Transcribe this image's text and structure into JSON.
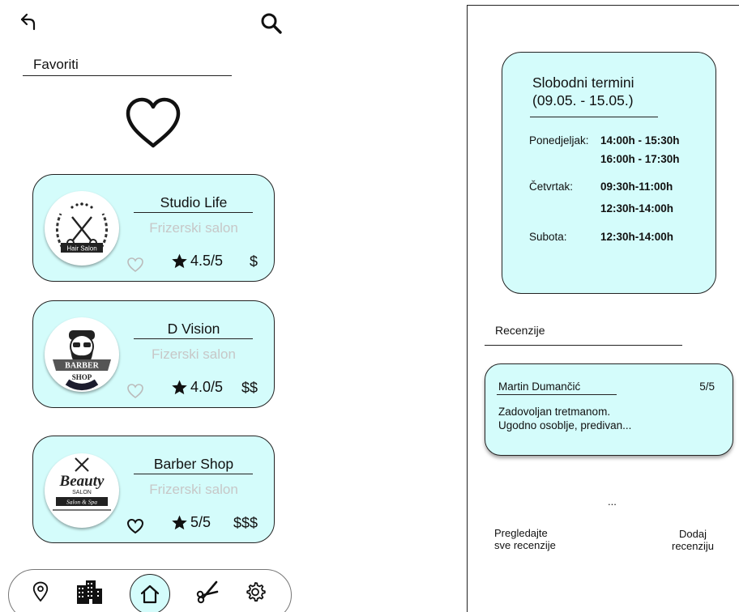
{
  "left_screen": {
    "title": "Favoriti",
    "cards": [
      {
        "name": "Studio Life",
        "type": "Frizerski salon",
        "rating": "4.5/5",
        "price": "$",
        "logo_text": "Hair Salon",
        "favorited": false
      },
      {
        "name": "D Vision",
        "type": "Fizerski salon",
        "rating": "4.0/5",
        "price": "$$",
        "logo_text_top": "BARBER",
        "logo_text_bottom": "SHOP",
        "favorited": false
      },
      {
        "name": "Barber Shop",
        "type": "Frizerski salon",
        "rating": "5/5",
        "price": "$$$",
        "logo_text_top": "Beauty",
        "logo_text_mid": "SALON",
        "logo_text_bottom": "Salon & Spa",
        "favorited": true
      }
    ],
    "nav": [
      "location-icon",
      "buildings-icon",
      "home-icon",
      "scissors-icon",
      "settings-icon"
    ]
  },
  "right_screen": {
    "slots_title_line1": "Slobodni termini",
    "slots_title_line2": "(09.05. - 15.05.)",
    "days": [
      {
        "day": "Ponedjeljak:",
        "times": [
          "14:00h - 15:30h",
          "16:00h - 17:30h"
        ]
      },
      {
        "day": "Četvrtak:",
        "times": [
          "09:30h-11:00h",
          "12:30h-14:00h"
        ]
      },
      {
        "day": "Subota:",
        "times": [
          "12:30h-14:00h"
        ]
      }
    ],
    "reviews_title": "Recenzije",
    "review": {
      "author": "Martin Dumančić",
      "score": "5/5",
      "line1": "Zadovoljan tretmanom.",
      "line2": "Ugodno osoblje, predivan..."
    },
    "ellipsis": "...",
    "all_reviews_line1": "Pregledajte",
    "all_reviews_line2": "sve recenzije",
    "add_review_line1": "Dodaj",
    "add_review_line2": "recenziju"
  },
  "colors": {
    "card_bg": "#d4fcfb",
    "muted_text": "#c7c7c7",
    "border": "#222222"
  }
}
